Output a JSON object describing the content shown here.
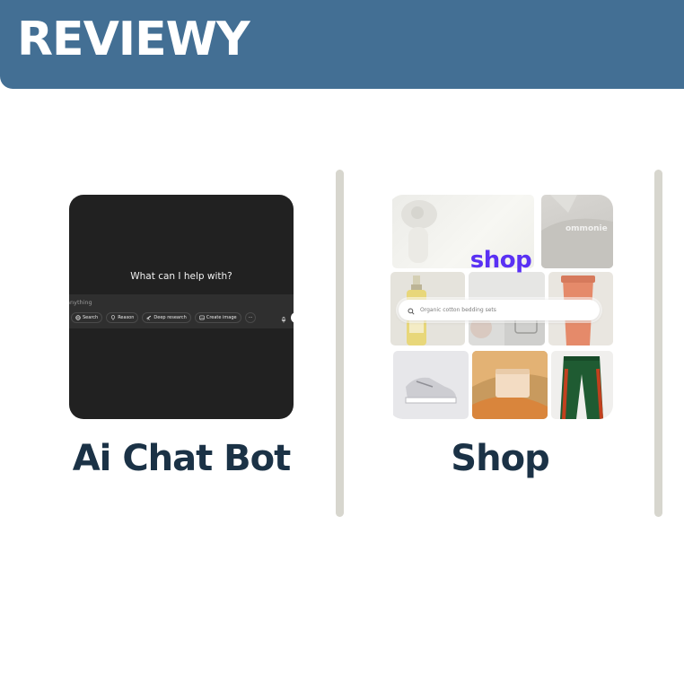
{
  "banner": {
    "title": "REVIEWY"
  },
  "chat": {
    "heading": "What can I help with?",
    "placeholder": "anything",
    "tools": [
      {
        "label": "Search",
        "icon": "globe-icon"
      },
      {
        "label": "Reason",
        "icon": "lightbulb-icon"
      },
      {
        "label": "Deep research",
        "icon": "telescope-icon"
      },
      {
        "label": "Create image",
        "icon": "image-icon"
      }
    ],
    "more_label": "···",
    "label": "Ai Chat Bot"
  },
  "shop": {
    "logo": "shop",
    "watermark": "ommonie",
    "search_placeholder": "Organic cotton bedding sets",
    "label": "Shop"
  },
  "colors": {
    "banner": "#436f94",
    "label_text": "#1b3246",
    "divider": "#d7d6ce",
    "chat_bg": "#212121",
    "shop_brand": "#5a31f4"
  }
}
